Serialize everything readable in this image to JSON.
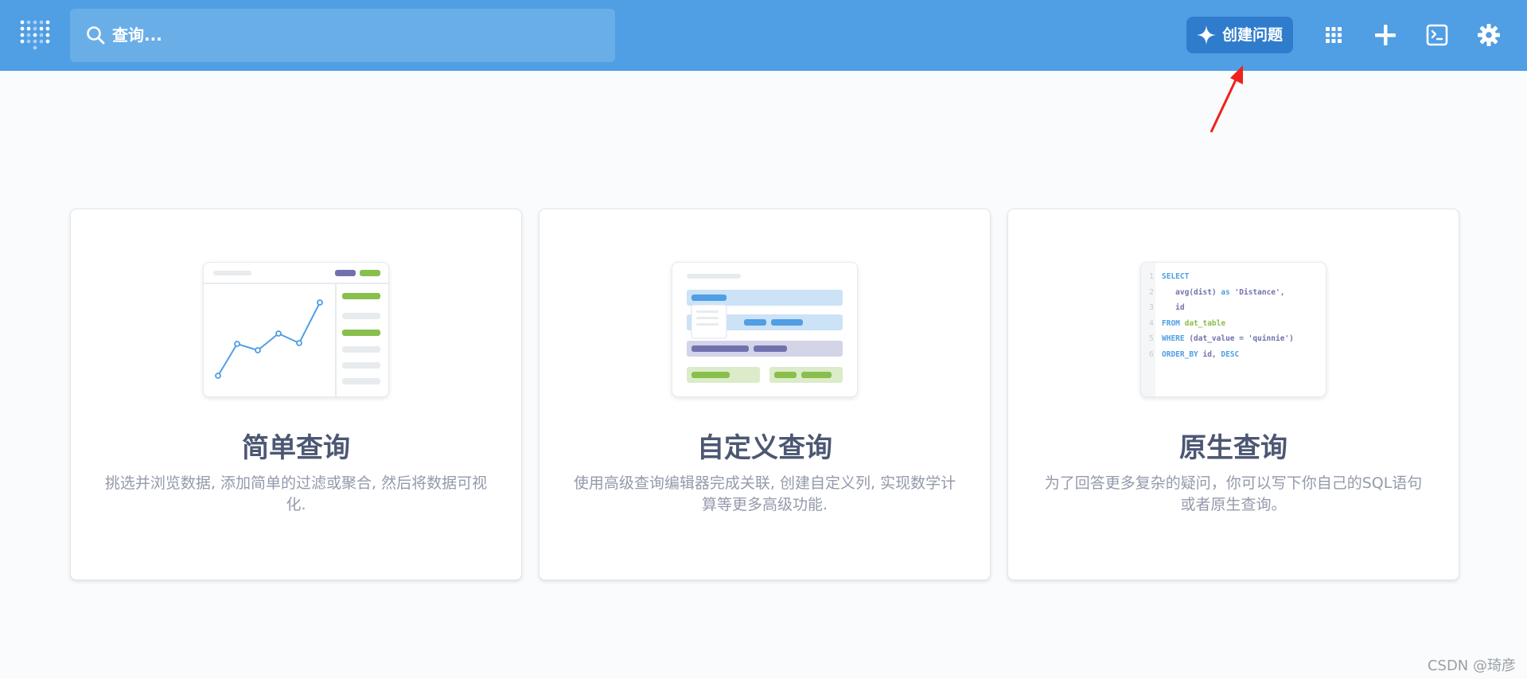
{
  "header": {
    "search_placeholder": "查询...",
    "create_button_label": "创建问题",
    "icons": [
      "app-grid-icon",
      "plus-icon",
      "terminal-icon",
      "gear-icon"
    ]
  },
  "cards": [
    {
      "title": "简单查询",
      "description": "挑选并浏览数据, 添加简单的过滤或聚合, 然后将数据可视化."
    },
    {
      "title": "自定义查询",
      "description": "使用高级查询编辑器完成关联, 创建自定义列, 实现数学计算等更多高级功能."
    },
    {
      "title": "原生查询",
      "description": "为了回答更多复杂的疑问，你可以写下你自己的SQL语句或者原生查询。",
      "code_lines": [
        {
          "num": "1",
          "parts": [
            [
              "kw",
              "SELECT"
            ]
          ]
        },
        {
          "num": "2",
          "parts": [
            [
              "fn",
              "   avg(dist) "
            ],
            [
              "kw",
              "as"
            ],
            [
              "str",
              " 'Distance',"
            ]
          ]
        },
        {
          "num": "3",
          "parts": [
            [
              "fn",
              "   id"
            ]
          ]
        },
        {
          "num": "4",
          "parts": [
            [
              "kw",
              "FROM "
            ],
            [
              "grn",
              "dat_table"
            ]
          ]
        },
        {
          "num": "5",
          "parts": [
            [
              "kw",
              "WHERE "
            ],
            [
              "fn",
              "(dat_value = 'quinnie')"
            ]
          ]
        },
        {
          "num": "6",
          "parts": [
            [
              "kw",
              "ORDER_BY "
            ],
            [
              "fn",
              "id, "
            ],
            [
              "kw",
              "DESC"
            ]
          ]
        }
      ]
    }
  ],
  "watermark": "CSDN @琦彦",
  "colors": {
    "header_bg": "#509ee3",
    "button_bg": "#2f7ccc",
    "title": "#4c5773",
    "description": "#949aab",
    "green": "#88bf4d",
    "purple": "#7172ad"
  }
}
